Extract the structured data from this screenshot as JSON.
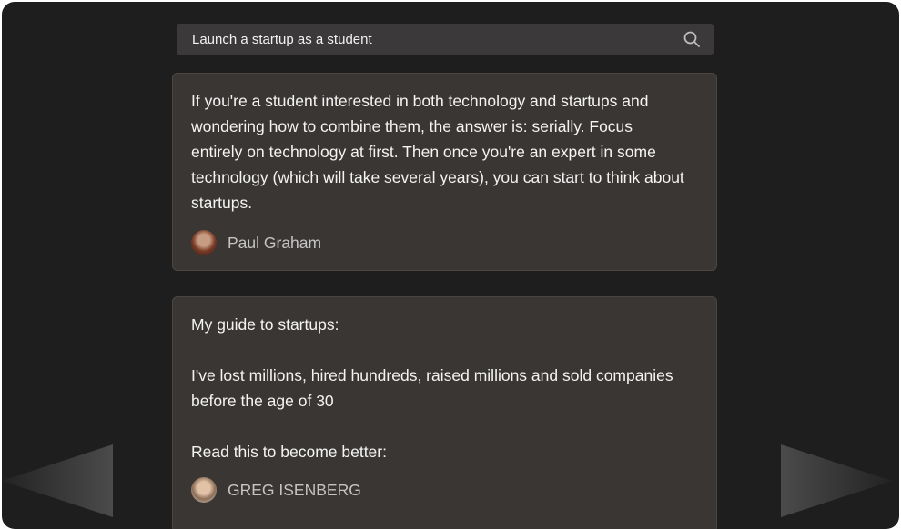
{
  "search": {
    "query": "Launch a startup as a student",
    "icon": "search-icon"
  },
  "cards": [
    {
      "lines": [
        "If you're a student interested in both technology and startups and",
        "wondering how to combine them, the answer is: serially. Focus",
        "entirely on technology at first. Then once you're an expert in some",
        "technology (which will take several years), you can start to think about",
        "startups."
      ],
      "author": "Paul Graham"
    },
    {
      "lines": [
        "My guide to startups:",
        "",
        "I've lost millions, hired hundreds, raised millions and sold companies",
        "before the age of 30",
        "",
        "Read this to become better:"
      ],
      "author": "GREG ISENBERG"
    }
  ],
  "colors": {
    "background": "#1f1e1e",
    "card": "#3a3633",
    "search_bar": "#3b3939"
  }
}
